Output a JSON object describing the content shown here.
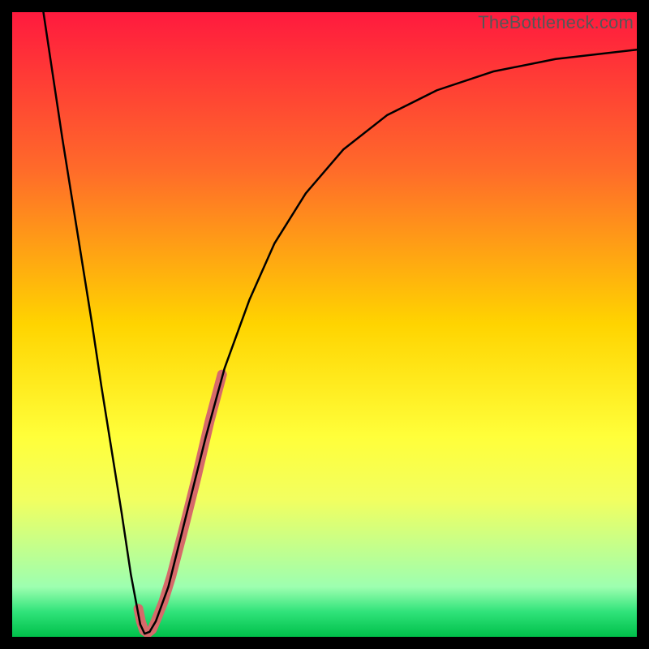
{
  "watermark": "TheBottleneck.com",
  "chart_data": {
    "type": "line",
    "title": "",
    "xlabel": "",
    "ylabel": "",
    "xlim": [
      0,
      100
    ],
    "ylim": [
      0,
      100
    ],
    "gradient_stops": [
      {
        "y_pct": 0,
        "color": "#ff1a3e"
      },
      {
        "y_pct": 25,
        "color": "#ff6a2a"
      },
      {
        "y_pct": 50,
        "color": "#ffd400"
      },
      {
        "y_pct": 68,
        "color": "#ffff3a"
      },
      {
        "y_pct": 78,
        "color": "#f2ff60"
      },
      {
        "y_pct": 92,
        "color": "#9dffb0"
      },
      {
        "y_pct": 96,
        "color": "#30e37a"
      },
      {
        "y_pct": 100,
        "color": "#00c04a"
      }
    ],
    "series": [
      {
        "name": "bottleneck-curve",
        "stroke": "#000000",
        "stroke_width": 2.5,
        "points": [
          {
            "x": 5.0,
            "y": 100.0
          },
          {
            "x": 6.5,
            "y": 90.0
          },
          {
            "x": 8.0,
            "y": 80.0
          },
          {
            "x": 9.6,
            "y": 70.0
          },
          {
            "x": 11.2,
            "y": 60.0
          },
          {
            "x": 12.8,
            "y": 50.0
          },
          {
            "x": 14.3,
            "y": 40.0
          },
          {
            "x": 15.9,
            "y": 30.0
          },
          {
            "x": 17.5,
            "y": 20.0
          },
          {
            "x": 19.0,
            "y": 10.0
          },
          {
            "x": 20.5,
            "y": 2.0
          },
          {
            "x": 21.2,
            "y": 0.5
          },
          {
            "x": 22.0,
            "y": 0.8
          },
          {
            "x": 23.0,
            "y": 2.5
          },
          {
            "x": 25.0,
            "y": 8.0
          },
          {
            "x": 28.0,
            "y": 20.0
          },
          {
            "x": 31.0,
            "y": 32.0
          },
          {
            "x": 34.0,
            "y": 43.0
          },
          {
            "x": 38.0,
            "y": 54.0
          },
          {
            "x": 42.0,
            "y": 63.0
          },
          {
            "x": 47.0,
            "y": 71.0
          },
          {
            "x": 53.0,
            "y": 78.0
          },
          {
            "x": 60.0,
            "y": 83.5
          },
          {
            "x": 68.0,
            "y": 87.5
          },
          {
            "x": 77.0,
            "y": 90.5
          },
          {
            "x": 87.0,
            "y": 92.5
          },
          {
            "x": 100.0,
            "y": 94.0
          }
        ]
      },
      {
        "name": "highlight-segment",
        "stroke": "#d66a6a",
        "stroke_width": 12,
        "points": [
          {
            "x": 20.2,
            "y": 4.5
          },
          {
            "x": 20.6,
            "y": 2.5
          },
          {
            "x": 21.1,
            "y": 1.0
          },
          {
            "x": 21.7,
            "y": 0.6
          },
          {
            "x": 22.4,
            "y": 1.2
          },
          {
            "x": 23.0,
            "y": 2.6
          },
          {
            "x": 24.2,
            "y": 5.6
          },
          {
            "x": 25.5,
            "y": 9.8
          },
          {
            "x": 27.5,
            "y": 17.5
          },
          {
            "x": 29.5,
            "y": 25.5
          },
          {
            "x": 31.6,
            "y": 34.5
          },
          {
            "x": 33.6,
            "y": 42.0
          }
        ]
      }
    ]
  }
}
